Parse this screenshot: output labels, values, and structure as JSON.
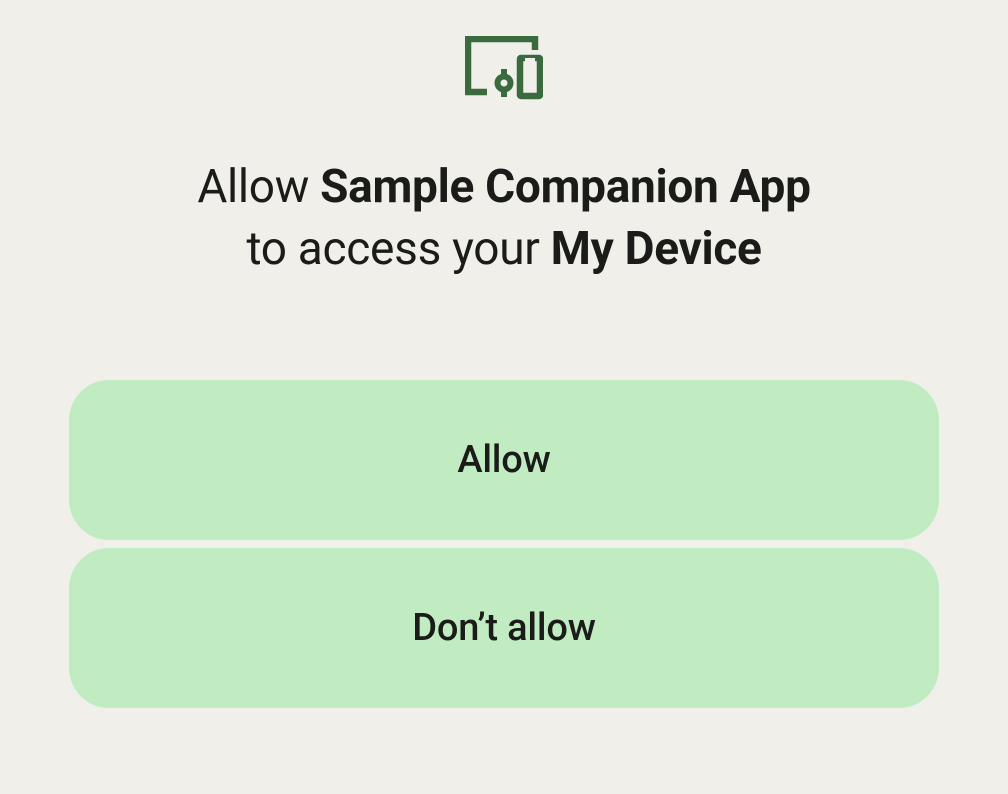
{
  "icon": "devices-icon",
  "title": {
    "prefix": "Allow ",
    "app_name": "Sample Companion App",
    "middle": " to access your ",
    "device_name": "My Device"
  },
  "buttons": {
    "allow": "Allow",
    "dont_allow": "Don’t allow"
  },
  "colors": {
    "background": "#f0efea",
    "button_bg": "#c1ecc1",
    "icon_color": "#3a6b3f",
    "text_color": "#1b1c19"
  }
}
